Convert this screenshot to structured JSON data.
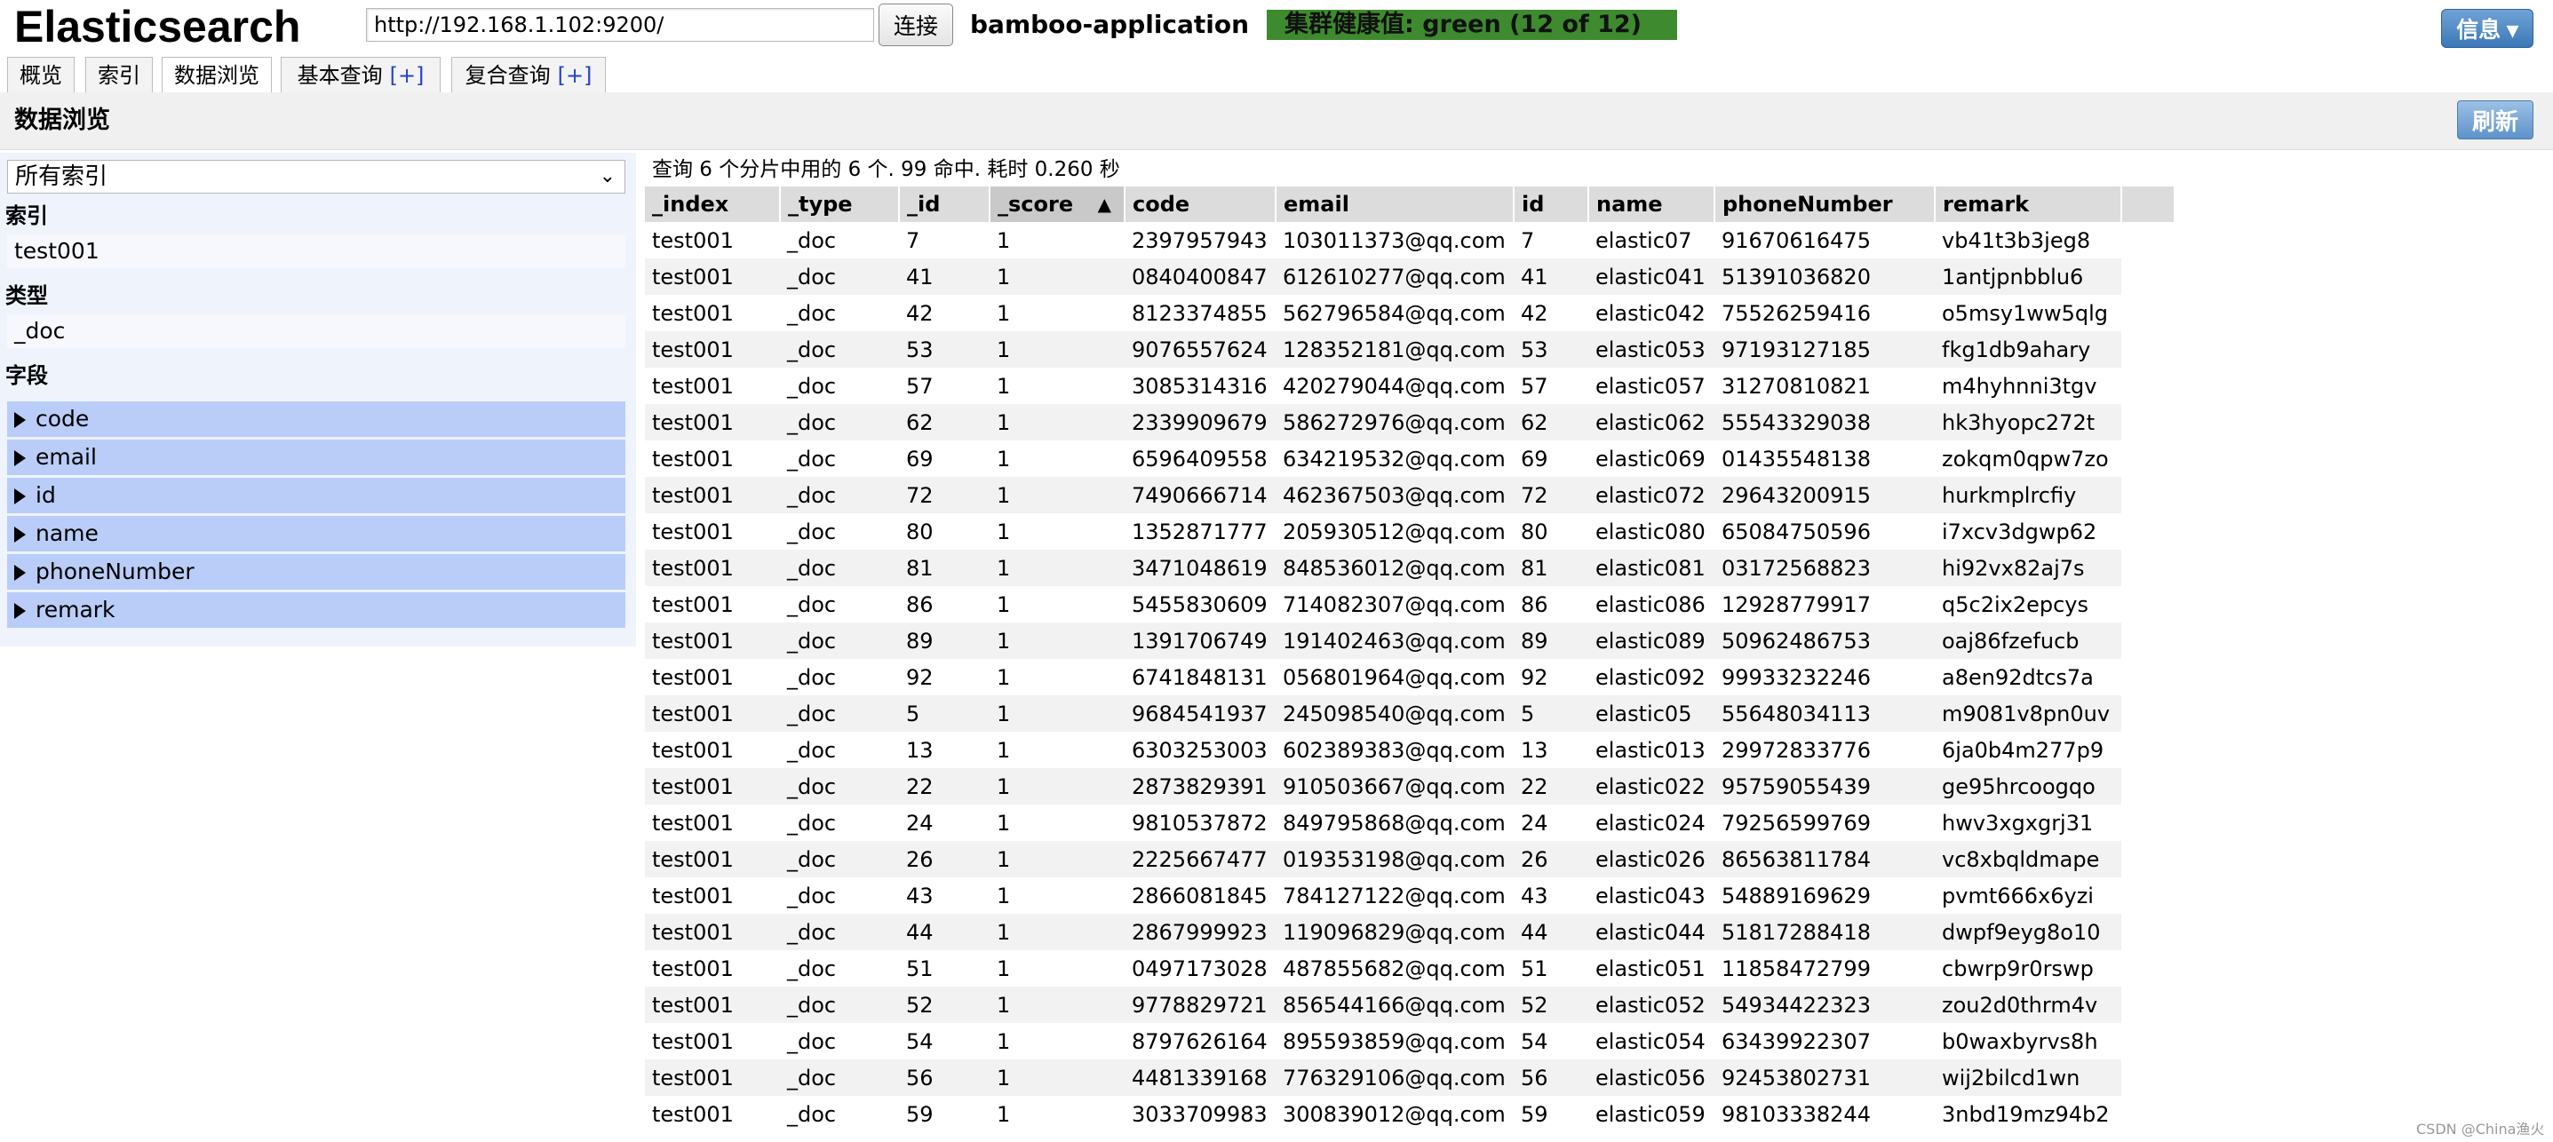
{
  "header": {
    "logo": "Elasticsearch",
    "url_value": "http://192.168.1.102:9200/",
    "connect_label": "连接",
    "cluster_name": "bamboo-application",
    "health_text": "集群健康值: green (12 of 12)",
    "info_label": "信息 ▾"
  },
  "tabs": [
    {
      "label": "概览"
    },
    {
      "label": "索引"
    },
    {
      "label": "数据浏览"
    },
    {
      "label": "基本查询",
      "plus": "[+]"
    },
    {
      "label": "复合查询",
      "plus": "[+]"
    }
  ],
  "page": {
    "title": "数据浏览",
    "refresh_label": "刷新"
  },
  "sidebar": {
    "select_value": "所有索引",
    "index_label": "索引",
    "index_value": "test001",
    "type_label": "类型",
    "type_value": "_doc",
    "fields_label": "字段",
    "fields": [
      "code",
      "email",
      "id",
      "name",
      "phoneNumber",
      "remark"
    ]
  },
  "results": {
    "summary": "查询 6 个分片中用的 6 个. 99 命中. 耗时 0.260 秒",
    "sorted_column": "_score",
    "columns": [
      "_index",
      "_type",
      "_id",
      "_score",
      "code",
      "email",
      "id",
      "name",
      "phoneNumber",
      "remark"
    ],
    "rows": [
      [
        "test001",
        "_doc",
        "7",
        "1",
        "2397957943",
        "103011373@qq.com",
        "7",
        "elastic07",
        "91670616475",
        "vb41t3b3jeg8"
      ],
      [
        "test001",
        "_doc",
        "41",
        "1",
        "0840400847",
        "612610277@qq.com",
        "41",
        "elastic041",
        "51391036820",
        "1antjpnbblu6"
      ],
      [
        "test001",
        "_doc",
        "42",
        "1",
        "8123374855",
        "562796584@qq.com",
        "42",
        "elastic042",
        "75526259416",
        "o5msy1ww5qlg"
      ],
      [
        "test001",
        "_doc",
        "53",
        "1",
        "9076557624",
        "128352181@qq.com",
        "53",
        "elastic053",
        "97193127185",
        "fkg1db9ahary"
      ],
      [
        "test001",
        "_doc",
        "57",
        "1",
        "3085314316",
        "420279044@qq.com",
        "57",
        "elastic057",
        "31270810821",
        "m4hyhnni3tgv"
      ],
      [
        "test001",
        "_doc",
        "62",
        "1",
        "2339909679",
        "586272976@qq.com",
        "62",
        "elastic062",
        "55543329038",
        "hk3hyopc272t"
      ],
      [
        "test001",
        "_doc",
        "69",
        "1",
        "6596409558",
        "634219532@qq.com",
        "69",
        "elastic069",
        "01435548138",
        "zokqm0qpw7zo"
      ],
      [
        "test001",
        "_doc",
        "72",
        "1",
        "7490666714",
        "462367503@qq.com",
        "72",
        "elastic072",
        "29643200915",
        "hurkmplrcfiy"
      ],
      [
        "test001",
        "_doc",
        "80",
        "1",
        "1352871777",
        "205930512@qq.com",
        "80",
        "elastic080",
        "65084750596",
        "i7xcv3dgwp62"
      ],
      [
        "test001",
        "_doc",
        "81",
        "1",
        "3471048619",
        "848536012@qq.com",
        "81",
        "elastic081",
        "03172568823",
        "hi92vx82aj7s"
      ],
      [
        "test001",
        "_doc",
        "86",
        "1",
        "5455830609",
        "714082307@qq.com",
        "86",
        "elastic086",
        "12928779917",
        "q5c2ix2epcys"
      ],
      [
        "test001",
        "_doc",
        "89",
        "1",
        "1391706749",
        "191402463@qq.com",
        "89",
        "elastic089",
        "50962486753",
        "oaj86fzefucb"
      ],
      [
        "test001",
        "_doc",
        "92",
        "1",
        "6741848131",
        "056801964@qq.com",
        "92",
        "elastic092",
        "99933232246",
        "a8en92dtcs7a"
      ],
      [
        "test001",
        "_doc",
        "5",
        "1",
        "9684541937",
        "245098540@qq.com",
        "5",
        "elastic05",
        "55648034113",
        "m9081v8pn0uv"
      ],
      [
        "test001",
        "_doc",
        "13",
        "1",
        "6303253003",
        "602389383@qq.com",
        "13",
        "elastic013",
        "29972833776",
        "6ja0b4m277p9"
      ],
      [
        "test001",
        "_doc",
        "22",
        "1",
        "2873829391",
        "910503667@qq.com",
        "22",
        "elastic022",
        "95759055439",
        "ge95hrcoogqo"
      ],
      [
        "test001",
        "_doc",
        "24",
        "1",
        "9810537872",
        "849795868@qq.com",
        "24",
        "elastic024",
        "79256599769",
        "hwv3xgxgrj31"
      ],
      [
        "test001",
        "_doc",
        "26",
        "1",
        "2225667477",
        "019353198@qq.com",
        "26",
        "elastic026",
        "86563811784",
        "vc8xbqldmape"
      ],
      [
        "test001",
        "_doc",
        "43",
        "1",
        "2866081845",
        "784127122@qq.com",
        "43",
        "elastic043",
        "54889169629",
        "pvmt666x6yzi"
      ],
      [
        "test001",
        "_doc",
        "44",
        "1",
        "2867999923",
        "119096829@qq.com",
        "44",
        "elastic044",
        "51817288418",
        "dwpf9eyg8o10"
      ],
      [
        "test001",
        "_doc",
        "51",
        "1",
        "0497173028",
        "487855682@qq.com",
        "51",
        "elastic051",
        "11858472799",
        "cbwrp9r0rswp"
      ],
      [
        "test001",
        "_doc",
        "52",
        "1",
        "9778829721",
        "856544166@qq.com",
        "52",
        "elastic052",
        "54934422323",
        "zou2d0thrm4v"
      ],
      [
        "test001",
        "_doc",
        "54",
        "1",
        "8797626164",
        "895593859@qq.com",
        "54",
        "elastic054",
        "63439922307",
        "b0waxbyrvs8h"
      ],
      [
        "test001",
        "_doc",
        "56",
        "1",
        "4481339168",
        "776329106@qq.com",
        "56",
        "elastic056",
        "92453802731",
        "wij2bilcd1wn"
      ],
      [
        "test001",
        "_doc",
        "59",
        "1",
        "3033709983",
        "300839012@qq.com",
        "59",
        "elastic059",
        "98103338244",
        "3nbd19mz94b2"
      ]
    ]
  },
  "watermark": "CSDN @China渔火"
}
